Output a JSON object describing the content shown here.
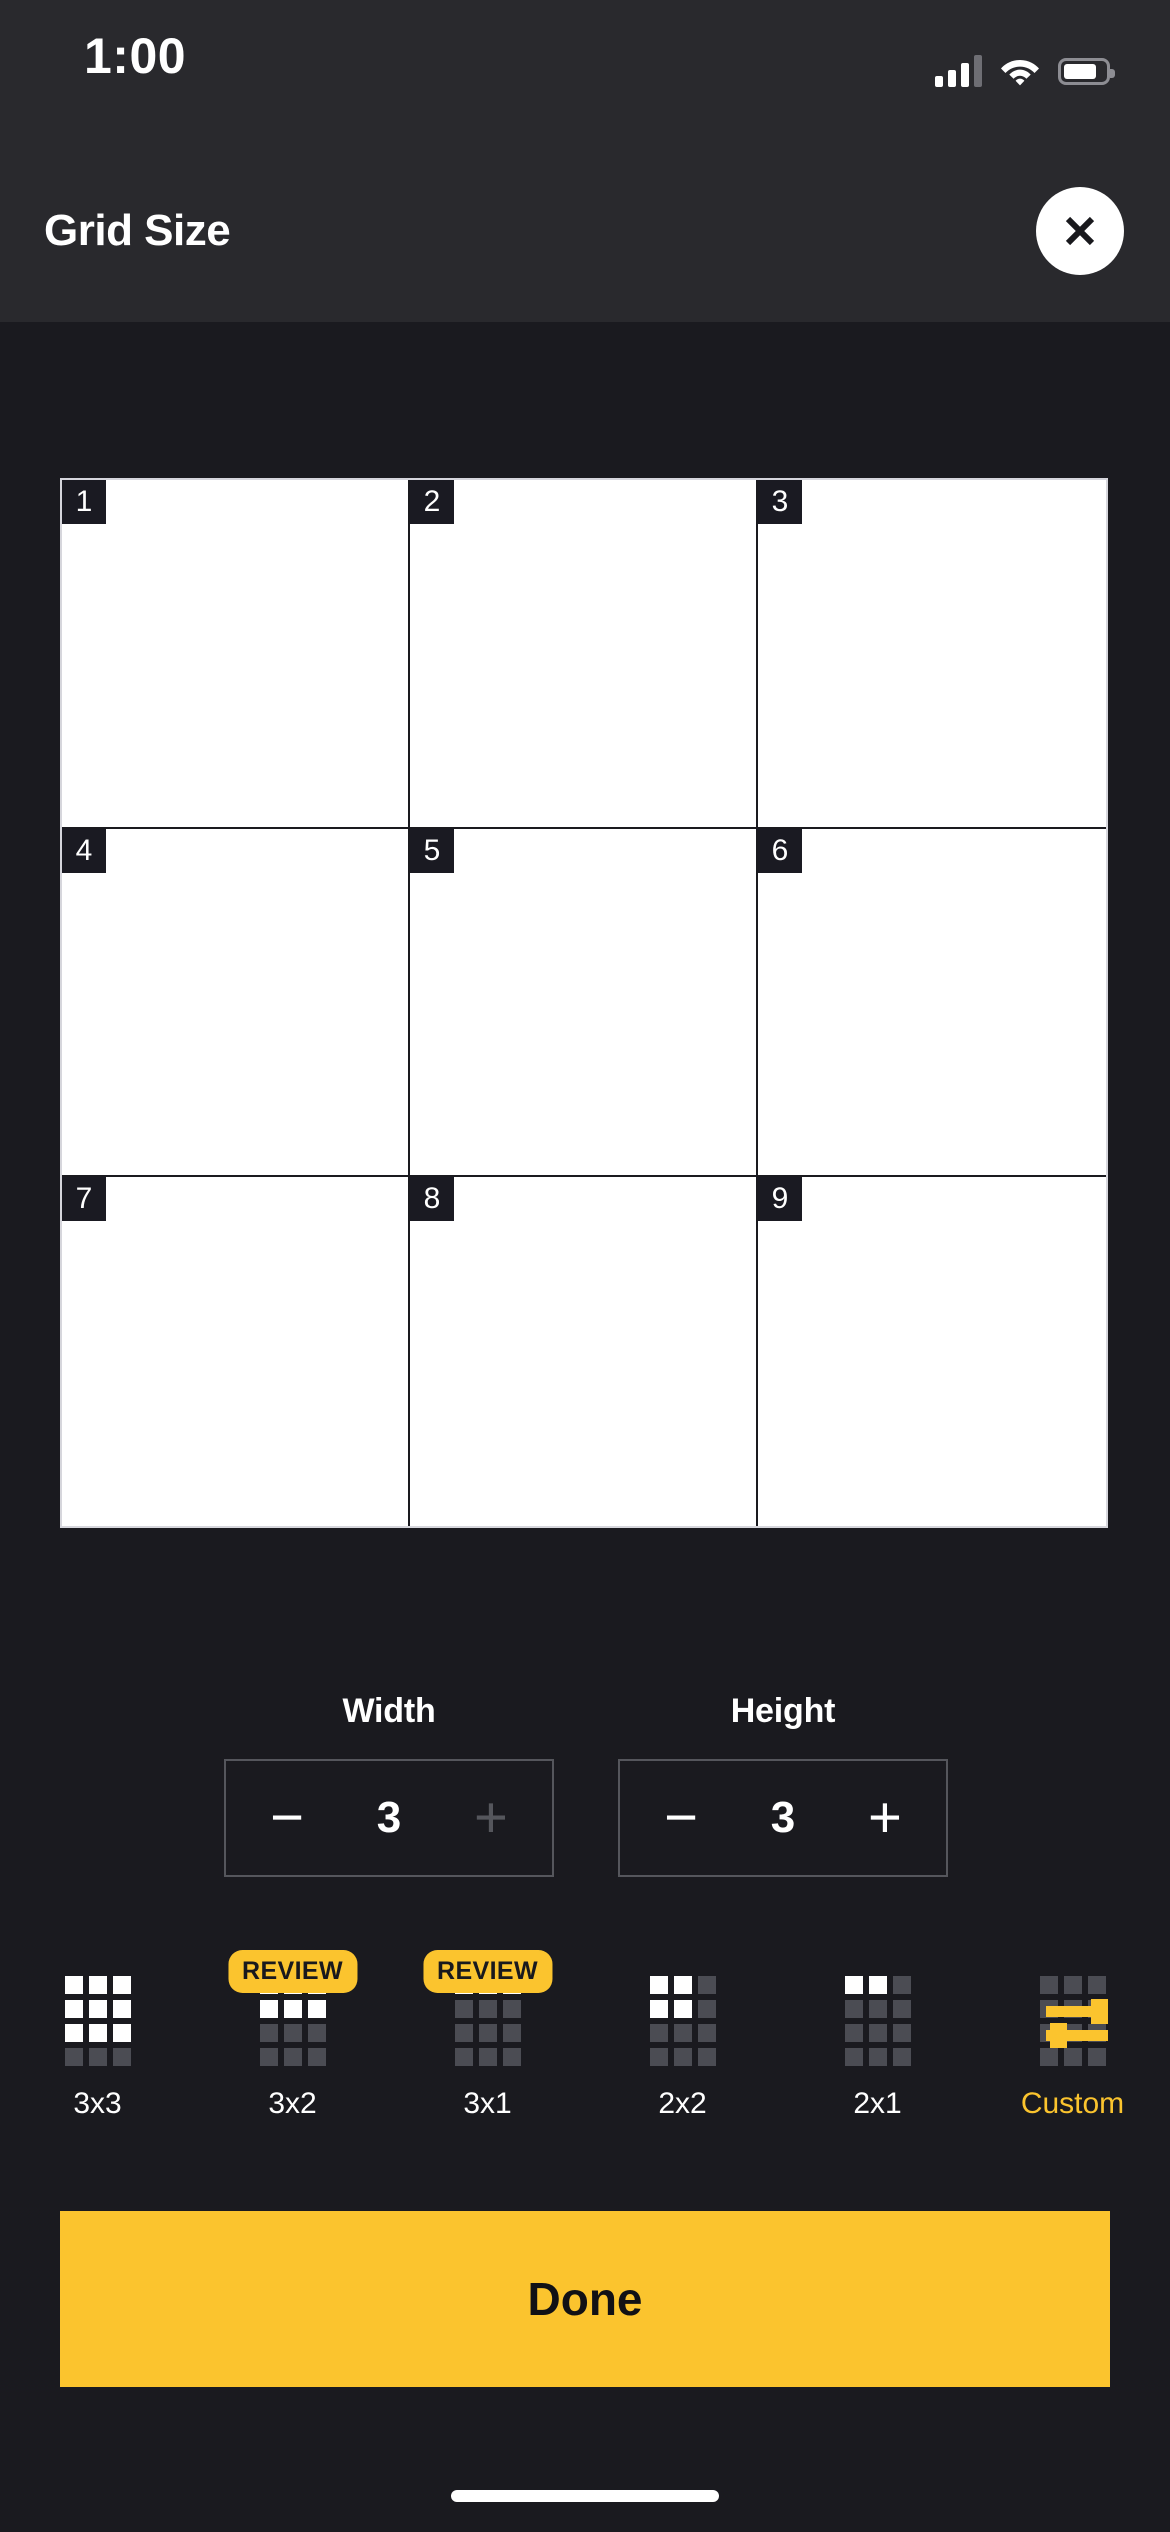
{
  "status_bar": {
    "time": "1:00",
    "signal_icon": "cellular-signal-icon",
    "wifi_icon": "wifi-icon",
    "battery_icon": "battery-icon"
  },
  "header": {
    "title": "Grid Size",
    "close_icon": "close-icon"
  },
  "grid_preview": {
    "columns": 3,
    "rows": 3,
    "cells": [
      "1",
      "2",
      "3",
      "4",
      "5",
      "6",
      "7",
      "8",
      "9"
    ]
  },
  "steppers": [
    {
      "label": "Width",
      "value": "3",
      "minus_label": "−",
      "plus_label": "+",
      "plus_enabled": false,
      "minus_enabled": true
    },
    {
      "label": "Height",
      "value": "3",
      "minus_label": "−",
      "plus_label": "+",
      "plus_enabled": true,
      "minus_enabled": true
    }
  ],
  "presets": [
    {
      "label": "3x3",
      "cols": 3,
      "rows": 3,
      "badge": "",
      "selected": false,
      "custom": false
    },
    {
      "label": "3x2",
      "cols": 3,
      "rows": 2,
      "badge": "REVIEW",
      "selected": false,
      "custom": false
    },
    {
      "label": "3x1",
      "cols": 3,
      "rows": 1,
      "badge": "REVIEW",
      "selected": false,
      "custom": false
    },
    {
      "label": "2x2",
      "cols": 2,
      "rows": 2,
      "badge": "",
      "selected": false,
      "custom": false
    },
    {
      "label": "2x1",
      "cols": 2,
      "rows": 1,
      "badge": "",
      "selected": false,
      "custom": false
    },
    {
      "label": "Custom",
      "cols": 0,
      "rows": 0,
      "badge": "",
      "selected": true,
      "custom": true
    }
  ],
  "done_button": {
    "label": "Done"
  },
  "colors": {
    "accent": "#fbc42e",
    "background": "#1a1a1f",
    "header_background": "#29292d",
    "dot_off": "#4b4c53",
    "dot_on": "#ffffff",
    "text": "#ffffff"
  }
}
